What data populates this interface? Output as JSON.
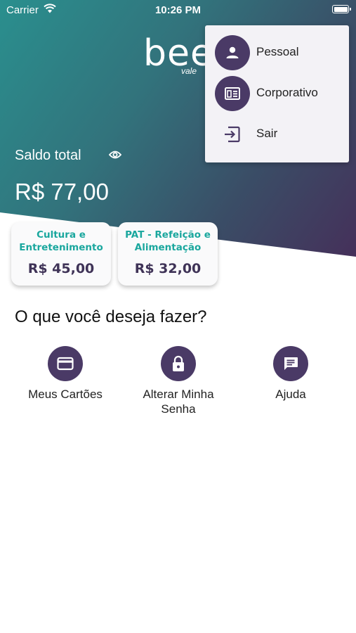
{
  "status_bar": {
    "carrier": "Carrier",
    "time": "10:26 PM"
  },
  "logo": {
    "text": "bee",
    "subtext": "vale"
  },
  "balance": {
    "label": "Saldo total",
    "value": "R$ 77,00",
    "visibility_icon": "eye-icon"
  },
  "cards": [
    {
      "name": "Cultura e Entretenimento",
      "amount": "R$ 45,00"
    },
    {
      "name": "PAT - Refeição e Alimentação",
      "amount": "R$ 32,00"
    }
  ],
  "question": "O que você deseja fazer?",
  "actions": [
    {
      "label": "Meus Cartões",
      "icon": "credit-card-icon"
    },
    {
      "label": "Alterar Minha Senha",
      "icon": "lock-icon"
    },
    {
      "label": "Ajuda",
      "icon": "chat-icon"
    }
  ],
  "menu": {
    "items": [
      {
        "label": "Pessoal",
        "icon": "person-icon"
      },
      {
        "label": "Corporativo",
        "icon": "building-icon"
      },
      {
        "label": "Sair",
        "icon": "logout-icon"
      }
    ]
  },
  "colors": {
    "accent": "#4a3a66",
    "teal": "#1aa79e",
    "gradient_start": "#2a8f8e",
    "gradient_end": "#45305a"
  }
}
